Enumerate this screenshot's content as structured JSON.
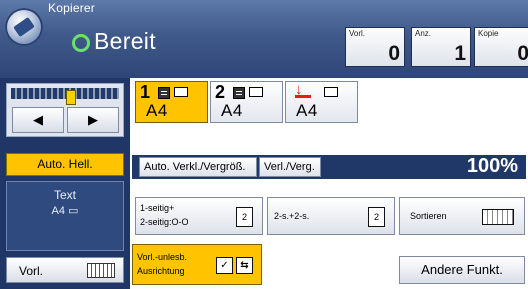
{
  "header": {
    "app_label": "Kopierer",
    "status": "Bereit",
    "counters": [
      {
        "label": "Vorl.",
        "value": "0"
      },
      {
        "label": "Anz.",
        "value": "1"
      },
      {
        "label": "Kopie",
        "value": "0"
      }
    ],
    "status_color": "#6ce06c"
  },
  "density": {
    "left_arrow": "◀",
    "right_arrow": "▶",
    "auto_label": "Auto. Hell."
  },
  "original_type": {
    "line1": "Text",
    "line2": "A4"
  },
  "original_button": {
    "label": "Vorl."
  },
  "trays": [
    {
      "number": "1",
      "size": "A4",
      "selected": true
    },
    {
      "number": "2",
      "size": "A4",
      "selected": false
    },
    {
      "number": "",
      "size": "A4",
      "selected": false,
      "bypass": true
    }
  ],
  "ratio": {
    "auto_label": "Auto. Verkl./Vergröß.",
    "manual_label": "Verl./Verg.",
    "value": "100%"
  },
  "duplex": {
    "option1_line1": "1-seitig+",
    "option1_line2": "2-seitig:O-O",
    "option2_label": "2-s.+2-s.",
    "option3_label": "Sortieren",
    "icon_glyph": "2"
  },
  "orientation": {
    "line1": "Vorl.-unlesb.",
    "line2": "Ausrichtung"
  },
  "other_functions": "Andere Funkt.",
  "colors": {
    "accent": "#ffc300",
    "header_blue": "#3f5a8a",
    "panel_navy": "#1f3666"
  }
}
